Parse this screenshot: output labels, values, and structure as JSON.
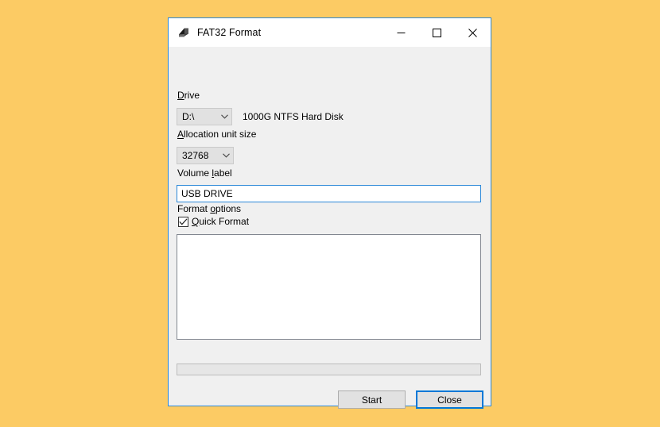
{
  "desktop": {
    "background_color": "#fccb64"
  },
  "window": {
    "title": "FAT32 Format",
    "icon": "drive-icon",
    "border_color": "#2b88d8",
    "titlebar_background": "#ffffff",
    "body_background": "#f0f0f0",
    "controls": {
      "minimize": "minimize-icon",
      "maximize": "maximize-icon",
      "close": "close-icon"
    }
  },
  "form": {
    "drive": {
      "label_pre": "D",
      "label_post": "rive",
      "selected": "D:\\",
      "options": [
        "D:\\"
      ],
      "info": "1000G NTFS Hard Disk"
    },
    "allocation": {
      "label_pre": "A",
      "label_post": "llocation unit size",
      "selected": "32768",
      "options": [
        "32768"
      ]
    },
    "volume": {
      "label_pre": "Volume ",
      "label_mid": "l",
      "label_post": "abel",
      "value": "USB DRIVE",
      "placeholder": ""
    },
    "format_options": {
      "label_pre": "Format ",
      "label_mid": "o",
      "label_post": "ptions",
      "quick_format": {
        "label_pre": "Q",
        "label_post": "uick Format",
        "checked": true,
        "check_glyph": "✓"
      }
    },
    "log": {
      "text": ""
    },
    "progress": {
      "percent": 0,
      "fill_color": "#06b025"
    }
  },
  "buttons": {
    "start": {
      "label": "Start",
      "focused": false
    },
    "close": {
      "label": "Close",
      "focused": true,
      "focus_color": "#0078d7"
    }
  }
}
